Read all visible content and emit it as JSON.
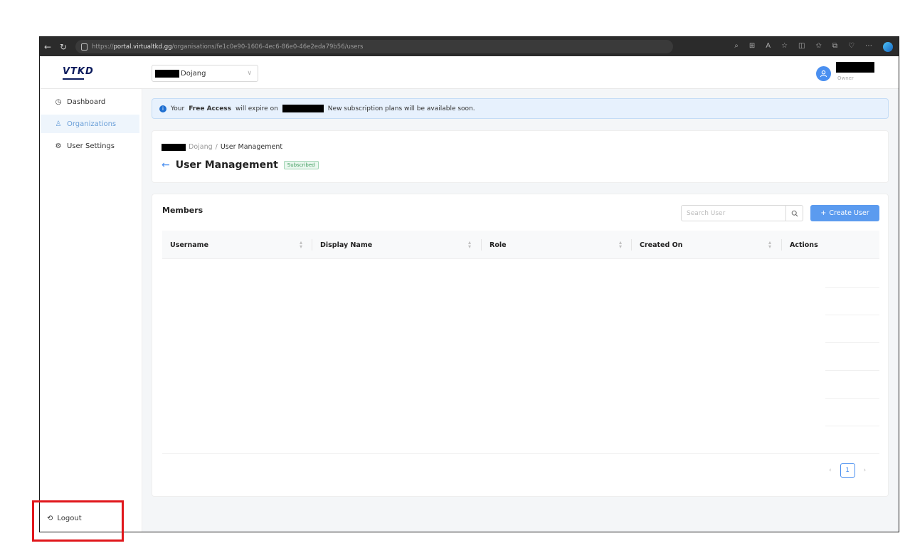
{
  "browser": {
    "url_prefix": "https://",
    "url_domain": "portal.virtualtkd.gg",
    "url_path": "/organisations/fe1c0e90-1606-4ec6-86e0-46e2eda79b56/users"
  },
  "header": {
    "logo": "VTKD",
    "org_select_value": "Dojang",
    "user_role": "Owner"
  },
  "sidebar": {
    "items": [
      {
        "label": "Dashboard",
        "icon": "clock-icon"
      },
      {
        "label": "Organizations",
        "icon": "users-icon"
      },
      {
        "label": "User Settings",
        "icon": "gear-icon"
      }
    ],
    "logout_label": "Logout"
  },
  "notice": {
    "prefix": "Your",
    "bold": "Free Access",
    "middle": "will expire on",
    "suffix": "New subscription plans will be available soon."
  },
  "page": {
    "breadcrumb_org": "Dojang",
    "breadcrumb_sep": "/",
    "breadcrumb_current": "User Management",
    "title": "User Management",
    "badge": "Subscribed"
  },
  "members": {
    "title": "Members",
    "search_placeholder": "Search User",
    "create_label": "Create User",
    "columns": [
      "Username",
      "Display Name",
      "Role",
      "Created On",
      "Actions"
    ],
    "page": "1"
  },
  "colors": {
    "accent": "#4a8ff0",
    "highlight": "#e0161b"
  }
}
